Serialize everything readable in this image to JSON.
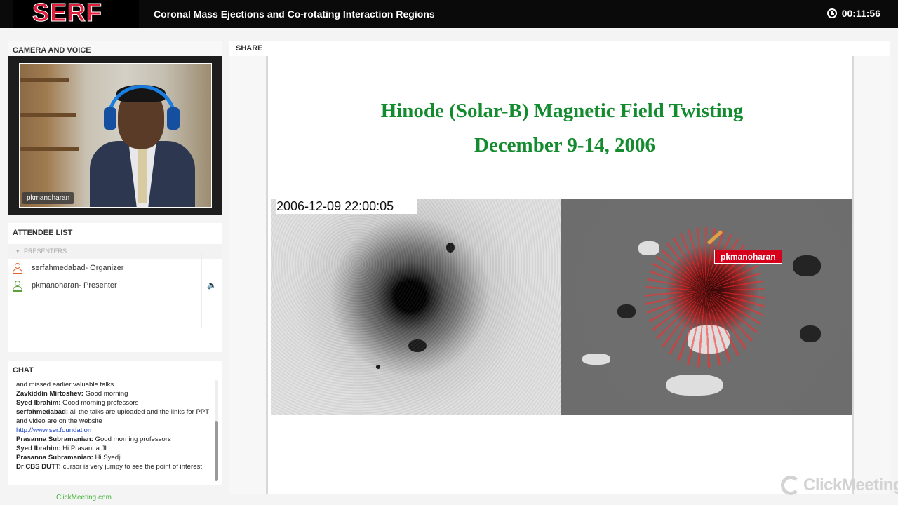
{
  "header": {
    "logo_text": "SERF",
    "title": "Coronal Mass Ejections and Co-rotating Interaction Regions",
    "timer": "00:11:56"
  },
  "camera": {
    "section_title": "CAMERA AND VOICE",
    "presenter_name": "pkmanoharan"
  },
  "attendees": {
    "section_title": "ATTENDEE LIST",
    "group_label": "PRESENTERS",
    "list": [
      {
        "name": "serfahmedabad",
        "role": " - Organizer"
      },
      {
        "name": "pkmanoharan",
        "role": " - Presenter"
      }
    ]
  },
  "chat": {
    "section_title": "CHAT",
    "messages": [
      {
        "author": "",
        "text": "and missed earlier valuable talks"
      },
      {
        "author": "Zavkiddin Mirtoshev:",
        "text": " Good morning"
      },
      {
        "author": "Syed Ibrahim:",
        "text": " Good morning professors"
      },
      {
        "author": "serfahmedabad:",
        "text": " all the talks are uploaded and the links for PPT and video are on the website"
      },
      {
        "author": "",
        "text": "http://www.ser.foundation",
        "link": true
      },
      {
        "author": "Prasanna Subramanian:",
        "text": " Good morning professors"
      },
      {
        "author": "Syed Ibrahim:",
        "text": " Hi Prasanna JI"
      },
      {
        "author": "Prasanna Subramanian:",
        "text": " Hi Syedji"
      },
      {
        "author": "Dr CBS DUTT:",
        "text": " cursor is very jumpy to see the point of interest"
      }
    ]
  },
  "footer": {
    "brand_link": "ClickMeeting.com"
  },
  "share": {
    "section_title": "SHARE",
    "slide_title_line1": "Hinode (Solar-B) Magnetic Field Twisting",
    "slide_title_line2": "December 9-14, 2006",
    "image_timestamp": "2006-12-09 22:00:05",
    "pointer_label": "pkmanoharan",
    "watermark": "ClickMeeting"
  },
  "colors": {
    "title_green": "#138b2e",
    "logo_red": "#e01f3d",
    "pointer_red": "#d6001c",
    "link_green": "#46b33c",
    "link_blue": "#1a44c7"
  }
}
